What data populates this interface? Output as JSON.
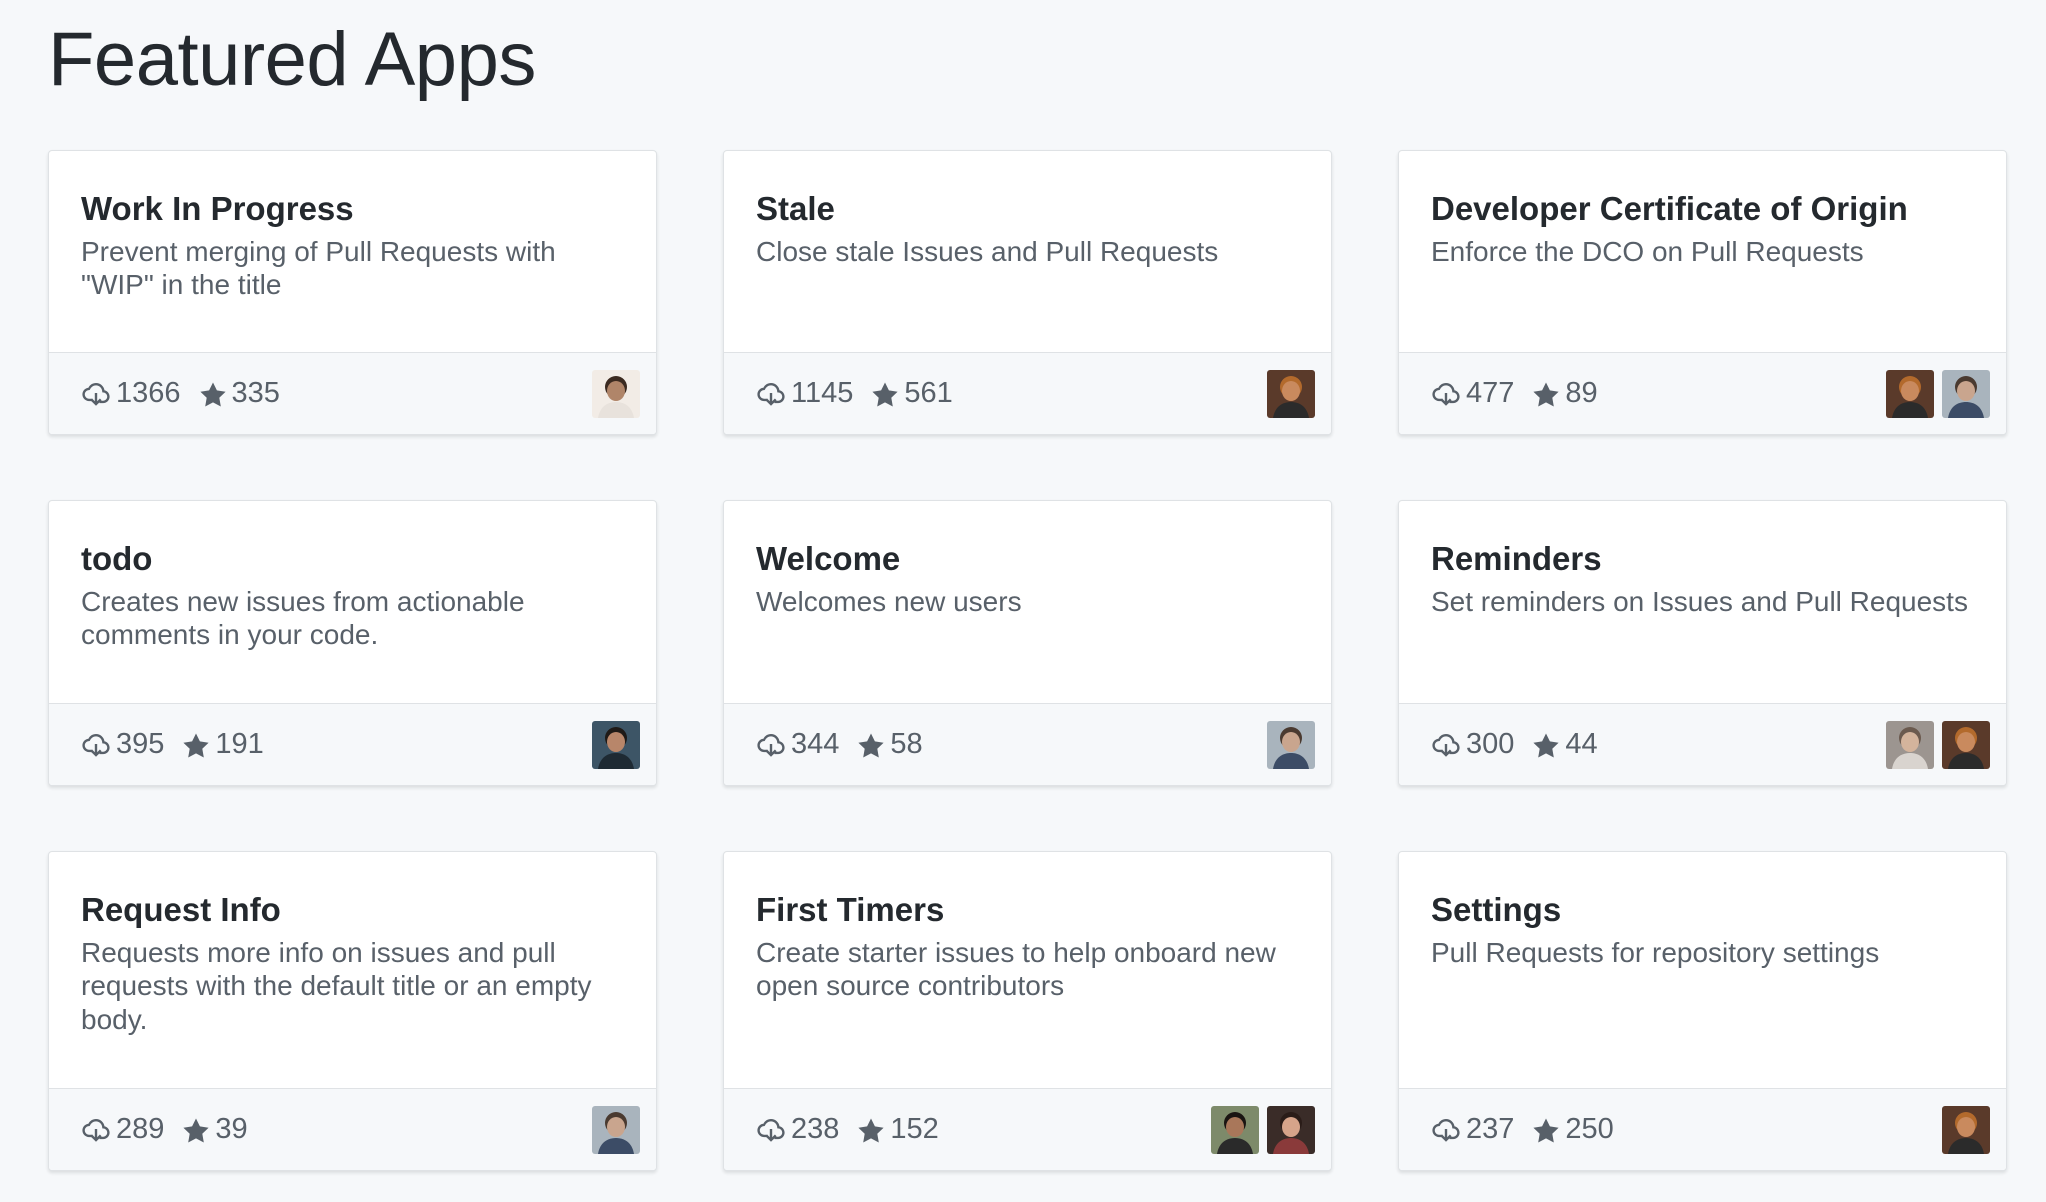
{
  "page": {
    "title": "Featured Apps"
  },
  "colors": {
    "background": "#f6f8fa",
    "card": "#ffffff",
    "border": "#dfe2e5",
    "title_text": "#24292e",
    "muted_text": "#586069"
  },
  "apps": [
    {
      "title": "Work In Progress",
      "description": "Prevent merging of Pull Requests with \"WIP\" in the title",
      "installs": "1366",
      "stars": "335",
      "avatars": [
        {
          "bg": "#f2ece6",
          "skin": "#b08569",
          "hair": "#3b2a20",
          "shirt": "#e8e2dc"
        }
      ]
    },
    {
      "title": "Stale",
      "description": "Close stale Issues and Pull Requests",
      "installs": "1145",
      "stars": "561",
      "avatars": [
        {
          "bg": "#5a3a2a",
          "skin": "#c98a5e",
          "hair": "#b36a2c",
          "shirt": "#2b2b2b"
        }
      ]
    },
    {
      "title": "Developer Certificate of Origin",
      "description": "Enforce the DCO on Pull Requests",
      "installs": "477",
      "stars": "89",
      "avatars": [
        {
          "bg": "#5a3a2a",
          "skin": "#c98a5e",
          "hair": "#b36a2c",
          "shirt": "#2b2b2b"
        },
        {
          "bg": "#a9b4bd",
          "skin": "#c9a58e",
          "hair": "#4a3a30",
          "shirt": "#3c4c66"
        }
      ]
    },
    {
      "title": "todo",
      "description": "Creates new issues from actionable comments in your code.",
      "installs": "395",
      "stars": "191",
      "avatars": [
        {
          "bg": "#3d5566",
          "skin": "#b8866a",
          "hair": "#1f1a17",
          "shirt": "#1e2a33"
        }
      ]
    },
    {
      "title": "Welcome",
      "description": "Welcomes new users",
      "installs": "344",
      "stars": "58",
      "avatars": [
        {
          "bg": "#a9b4bd",
          "skin": "#c9a58e",
          "hair": "#4a3a30",
          "shirt": "#3c4c66"
        }
      ]
    },
    {
      "title": "Reminders",
      "description": "Set reminders on Issues and Pull Requests",
      "installs": "300",
      "stars": "44",
      "avatars": [
        {
          "bg": "#9c9590",
          "skin": "#d4b49c",
          "hair": "#6b5a4e",
          "shirt": "#d9d4cf"
        },
        {
          "bg": "#5a3a2a",
          "skin": "#c98a5e",
          "hair": "#b36a2c",
          "shirt": "#2b2b2b"
        }
      ]
    },
    {
      "title": "Request Info",
      "description": "Requests more info on issues and pull requests with the default title or an empty body.",
      "installs": "289",
      "stars": "39",
      "avatars": [
        {
          "bg": "#a9b4bd",
          "skin": "#c9a58e",
          "hair": "#4a3a30",
          "shirt": "#3c4c66"
        }
      ]
    },
    {
      "title": "First Timers",
      "description": "Create starter issues to help onboard new open source contributors",
      "installs": "238",
      "stars": "152",
      "avatars": [
        {
          "bg": "#7d8a6a",
          "skin": "#a9775a",
          "hair": "#1a1412",
          "shirt": "#2a2a2a"
        },
        {
          "bg": "#3a2c28",
          "skin": "#d6a48a",
          "hair": "#2a1c18",
          "shirt": "#8a3a3a"
        }
      ]
    },
    {
      "title": "Settings",
      "description": "Pull Requests for repository settings",
      "installs": "237",
      "stars": "250",
      "avatars": [
        {
          "bg": "#5a3a2a",
          "skin": "#c98a5e",
          "hair": "#b36a2c",
          "shirt": "#2b2b2b"
        }
      ]
    }
  ]
}
